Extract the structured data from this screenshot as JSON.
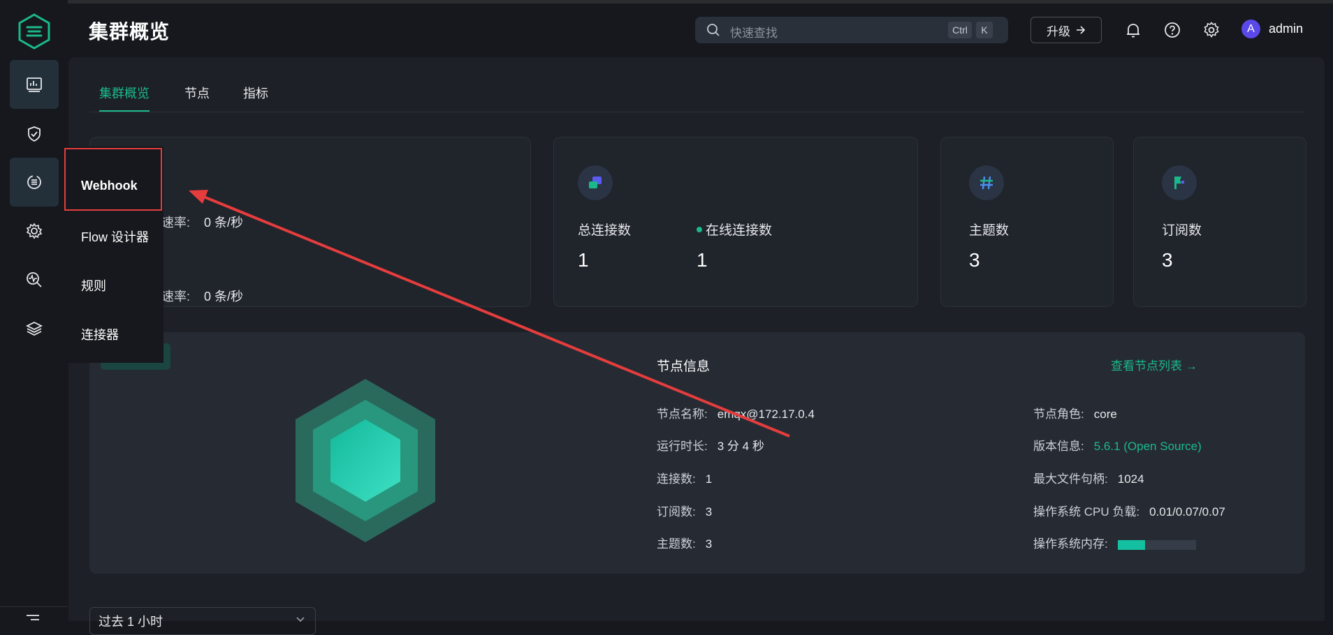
{
  "header": {
    "title": "集群概览",
    "search_placeholder": "快速查找",
    "kbd_ctrl": "Ctrl",
    "kbd_k": "K",
    "upgrade_label": "升级",
    "username": "admin",
    "avatar_initial": "A"
  },
  "tabs": [
    "集群概览",
    "节点",
    "指标"
  ],
  "rates": [
    {
      "label": "速率:",
      "value": "0 条/秒"
    },
    {
      "label": "速率:",
      "value": "0 条/秒"
    }
  ],
  "stats": {
    "total_connections": {
      "label": "总连接数",
      "value": "1"
    },
    "online_connections": {
      "label": "在线连接数",
      "value": "1"
    },
    "topics": {
      "label": "主题数",
      "value": "3"
    },
    "subscriptions": {
      "label": "订阅数",
      "value": "3"
    }
  },
  "node": {
    "title": "节点信息",
    "link": "查看节点列表 →",
    "left": [
      {
        "k": "节点名称:",
        "v": "emqx@172.17.0.4"
      },
      {
        "k": "运行时长:",
        "v": "3 分 4 秒"
      },
      {
        "k": "连接数:",
        "v": "1"
      },
      {
        "k": "订阅数:",
        "v": "3"
      },
      {
        "k": "主题数:",
        "v": "3"
      }
    ],
    "right": [
      {
        "k": "节点角色:",
        "v": "core"
      },
      {
        "k": "版本信息:",
        "v": "5.6.1 (Open Source)"
      },
      {
        "k": "最大文件句柄:",
        "v": "1024"
      },
      {
        "k": "操作系统 CPU 负载:",
        "v": "0.01/0.07/0.07"
      },
      {
        "k": "操作系统内存:",
        "v": ""
      }
    ],
    "memory_usage_fraction": 0.35
  },
  "time_select": {
    "value": "过去 1 小时"
  },
  "dropdown": {
    "items": [
      "Webhook",
      "Flow 设计器",
      "规则",
      "连接器"
    ]
  },
  "colors": {
    "accent": "#1bb98a",
    "highlight": "#e53d3d"
  }
}
